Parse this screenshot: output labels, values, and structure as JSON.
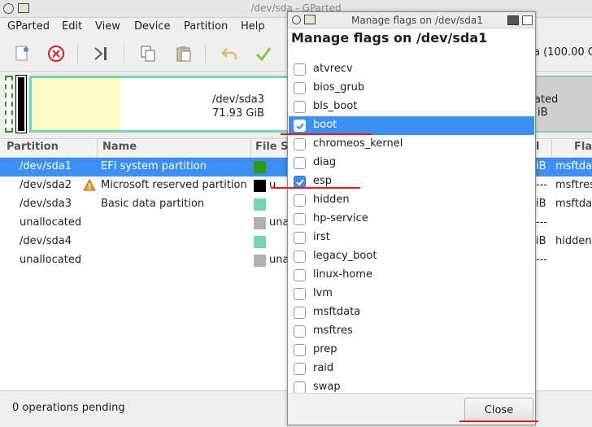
{
  "window": {
    "title": "/dev/sda - GParted"
  },
  "menubar": [
    "GParted",
    "Edit",
    "View",
    "Device",
    "Partition",
    "Help"
  ],
  "device_info": "a (100.00 G",
  "disk_map": {
    "sda3_name": "/dev/sda3",
    "sda3_size": "71.93 GiB",
    "right_line1": "ated",
    "right_line2": "iB"
  },
  "table": {
    "headers": [
      "Partition",
      "Name",
      "File S",
      "l",
      "Fla"
    ],
    "rows": [
      {
        "partition": "/dev/sda1",
        "name": "EFI system partition",
        "fs_color": "#2f9a1a",
        "fs_text": "",
        "size": "iB",
        "flags": "msftda",
        "selected": true,
        "warning": false
      },
      {
        "partition": "/dev/sda2",
        "name": "Microsoft reserved partition",
        "fs_color": "#000000",
        "fs_text": "u",
        "size": "---",
        "flags": "msftres",
        "selected": false,
        "warning": true
      },
      {
        "partition": "/dev/sda3",
        "name": "Basic data partition",
        "fs_color": "#77d4b3",
        "fs_text": "",
        "size": "iB",
        "flags": "msftda",
        "selected": false,
        "warning": false
      },
      {
        "partition": "unallocated",
        "name": "",
        "fs_color": "#b0b0b0",
        "fs_text": "una",
        "size": "---",
        "flags": "",
        "selected": false,
        "warning": false
      },
      {
        "partition": "/dev/sda4",
        "name": "",
        "fs_color": "#77d4b3",
        "fs_text": "",
        "size": "iB",
        "flags": "hidden",
        "selected": false,
        "warning": false
      },
      {
        "partition": "unallocated",
        "name": "",
        "fs_color": "#b0b0b0",
        "fs_text": "una",
        "size": "---",
        "flags": "",
        "selected": false,
        "warning": false
      }
    ]
  },
  "status": {
    "text": "0 operations pending"
  },
  "dialog": {
    "title": "Manage flags on /dev/sda1",
    "heading": "Manage flags on /dev/sda1",
    "flags": [
      {
        "label": "atvrecv",
        "checked": false,
        "selected": false
      },
      {
        "label": "bios_grub",
        "checked": false,
        "selected": false
      },
      {
        "label": "bls_boot",
        "checked": false,
        "selected": false
      },
      {
        "label": "boot",
        "checked": true,
        "selected": true
      },
      {
        "label": "chromeos_kernel",
        "checked": false,
        "selected": false
      },
      {
        "label": "diag",
        "checked": false,
        "selected": false
      },
      {
        "label": "esp",
        "checked": true,
        "selected": false
      },
      {
        "label": "hidden",
        "checked": false,
        "selected": false
      },
      {
        "label": "hp-service",
        "checked": false,
        "selected": false
      },
      {
        "label": "irst",
        "checked": false,
        "selected": false
      },
      {
        "label": "legacy_boot",
        "checked": false,
        "selected": false
      },
      {
        "label": "linux-home",
        "checked": false,
        "selected": false
      },
      {
        "label": "lvm",
        "checked": false,
        "selected": false
      },
      {
        "label": "msftdata",
        "checked": false,
        "selected": false
      },
      {
        "label": "msftres",
        "checked": false,
        "selected": false
      },
      {
        "label": "prep",
        "checked": false,
        "selected": false
      },
      {
        "label": "raid",
        "checked": false,
        "selected": false
      },
      {
        "label": "swap",
        "checked": false,
        "selected": false
      }
    ],
    "close_label": "Close"
  },
  "colors": {
    "accent": "#3b8ff0",
    "annotation": "#e11b1b"
  }
}
